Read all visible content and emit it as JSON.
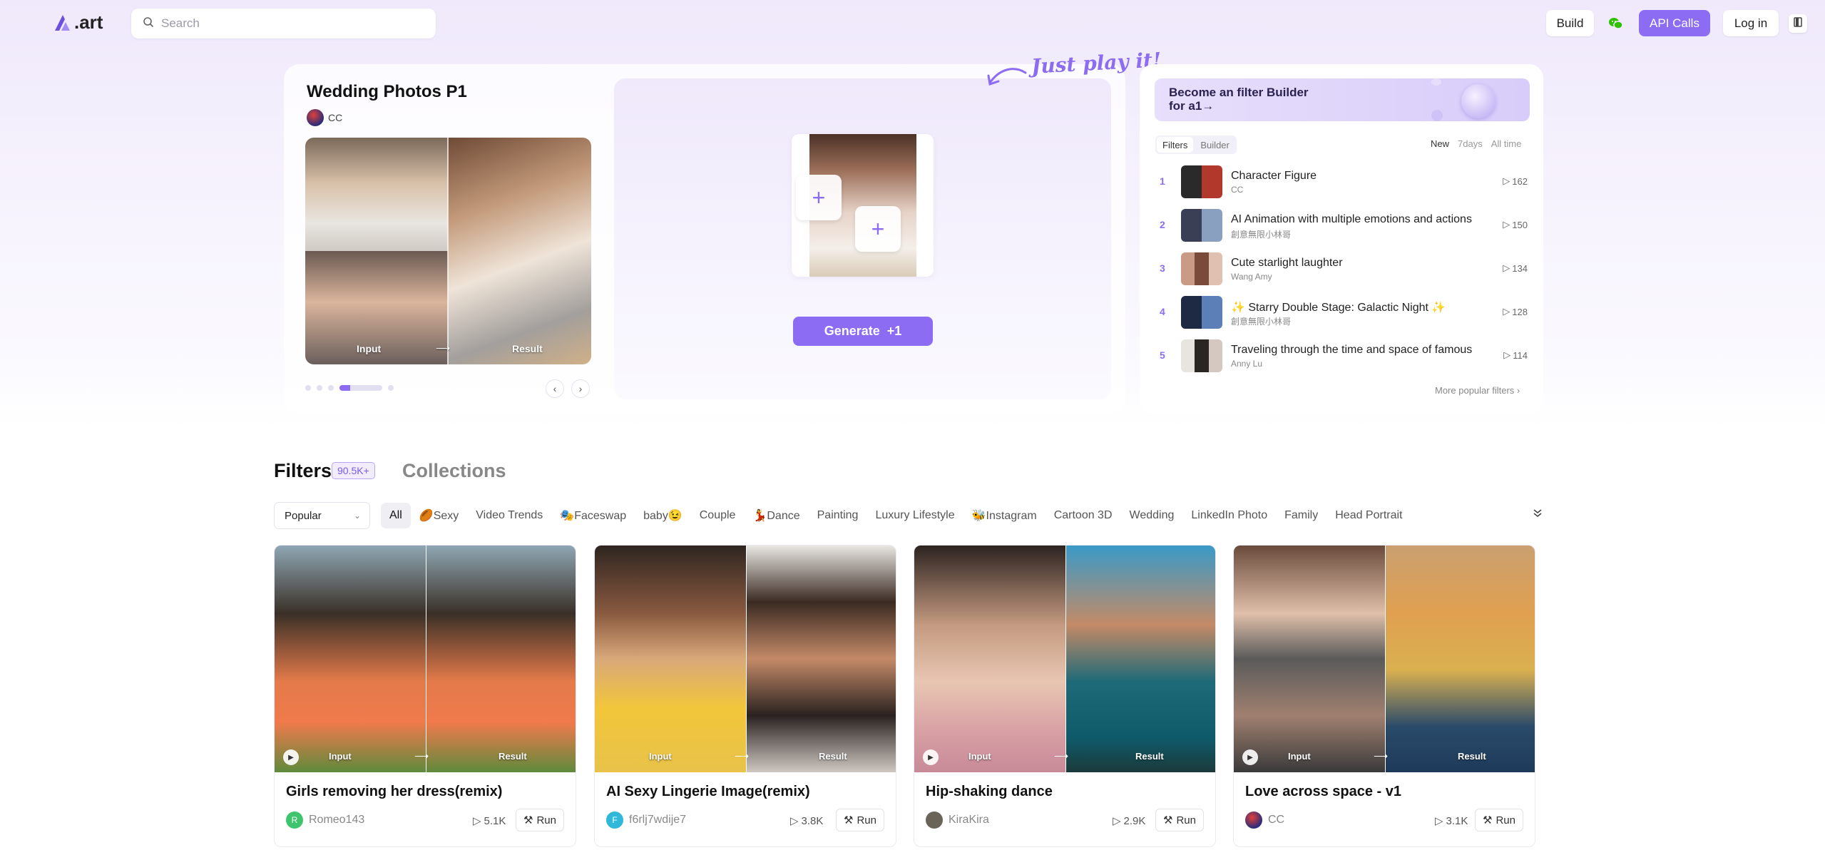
{
  "header": {
    "logo_text": ".art",
    "search_placeholder": "Search",
    "build_label": "Build",
    "api_calls_label": "API Calls",
    "login_label": "Log in"
  },
  "hero": {
    "title": "Wedding Photos P1",
    "author": "CC",
    "input_caption": "Input",
    "result_caption": "Result",
    "tagline": "Just play it!",
    "generate_label": "Generate",
    "generate_cost": "+1"
  },
  "leaderboard": {
    "banner_line1": "Become an filter Builder",
    "banner_line2": "for a1→",
    "tabs": [
      "Filters",
      "Builder"
    ],
    "periods": [
      "New",
      "7days",
      "All time"
    ],
    "items": [
      {
        "rank": "1",
        "name": "Character Figure",
        "author": "CC",
        "count": "162"
      },
      {
        "rank": "2",
        "name": "AI Animation with multiple emotions and actions",
        "author": "創意無限小林哥",
        "count": "150"
      },
      {
        "rank": "3",
        "name": "Cute starlight laughter",
        "author": "Wang Amy",
        "count": "134"
      },
      {
        "rank": "4",
        "name": "✨ Starry Double Stage: Galactic Night ✨",
        "author": "創意無限小林哥",
        "count": "128"
      },
      {
        "rank": "5",
        "name": "Traveling through the time and space of famous",
        "author": "Anny Lu",
        "count": "114"
      }
    ],
    "more_label": "More popular filters"
  },
  "filters": {
    "title": "Filters",
    "count": "90.5K+",
    "collections_label": "Collections",
    "sort_value": "Popular",
    "categories": [
      "All",
      "Sexy",
      "Video Trends",
      "Faceswap",
      "baby",
      "Couple",
      "Dance",
      "Painting",
      "Luxury Lifestyle",
      "Instagram",
      "Cartoon 3D",
      "Wedding",
      "LinkedIn Photo",
      "Family",
      "Head Portrait"
    ],
    "category_icons": [
      "",
      "🏉",
      "",
      "🎭",
      "",
      "",
      "💃",
      "",
      "",
      "🐝",
      "",
      "",
      "",
      "",
      ""
    ],
    "baby_suffix": "😉",
    "cards": [
      {
        "title": "Girls removing her dress(remix)",
        "author": "Romeo143",
        "avatar_letter": "R",
        "avatar_color": "#3ec46d",
        "count": "5.1K",
        "run": "Run",
        "input": "Input",
        "result": "Result"
      },
      {
        "title": "AI Sexy Lingerie Image(remix)",
        "author": "f6rlj7wdije7",
        "avatar_letter": "F",
        "avatar_color": "#2fb8d8",
        "count": "3.8K",
        "run": "Run",
        "input": "Input",
        "result": "Result"
      },
      {
        "title": "Hip-shaking dance",
        "author": "KiraKira",
        "avatar_letter": "",
        "avatar_color": "#6a6458",
        "count": "2.9K",
        "run": "Run",
        "input": "Input",
        "result": "Result"
      },
      {
        "title": "Love across space - v1",
        "author": "CC",
        "avatar_letter": "",
        "avatar_color": "#c0392b",
        "count": "3.1K",
        "run": "Run",
        "input": "Input",
        "result": "Result"
      }
    ]
  },
  "colors": {
    "accent": "#8c6cf2",
    "background_top": "#efe9fb"
  }
}
